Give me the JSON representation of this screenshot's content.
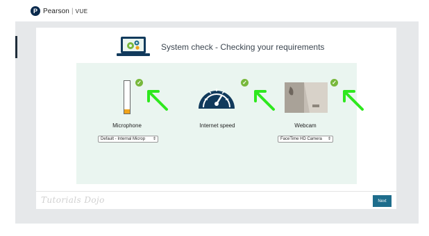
{
  "brand": {
    "name": "Pearson",
    "product": "VUE"
  },
  "page": {
    "title": "System check - Checking your requirements"
  },
  "checks": [
    {
      "label": "Microphone",
      "status": "passed",
      "select_value": "Default - Internal Microp",
      "level_fraction": 0.12
    },
    {
      "label": "Internet speed",
      "status": "passed"
    },
    {
      "label": "Webcam",
      "status": "passed",
      "select_value": "FaceTime HD Camera"
    }
  ],
  "footer": {
    "watermark": "Tutorials Dojo",
    "next_label": "Next"
  },
  "colors": {
    "accent": "#1e6d8c",
    "check": "#78b83c",
    "annotation_arrow": "#2ee81e",
    "gauge": "#113a5c",
    "panel": "#eaf5f0",
    "mic_level": "#f0a31a"
  },
  "icons": {
    "check": "checkmark-icon",
    "header": "laptop-gears-icon",
    "speed": "speedometer-icon"
  }
}
